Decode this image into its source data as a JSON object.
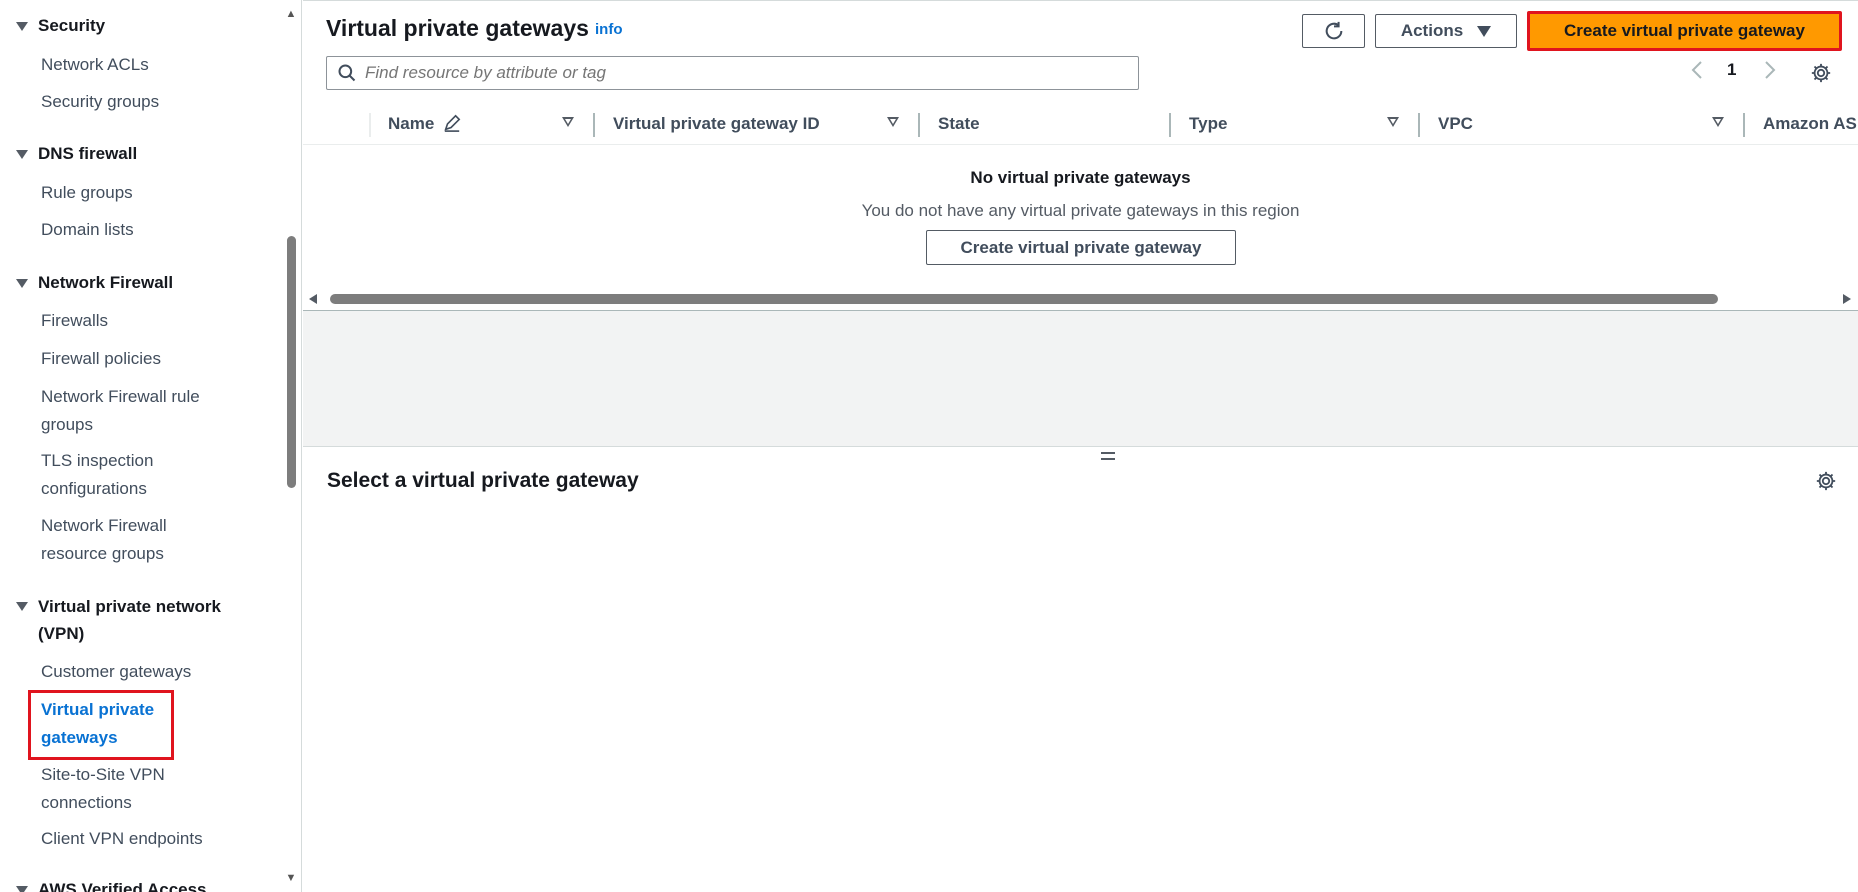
{
  "sidebar": {
    "sections": [
      {
        "label": "Security",
        "items": [
          "Network ACLs",
          "Security groups"
        ]
      },
      {
        "label": "DNS firewall",
        "items": [
          "Rule groups",
          "Domain lists"
        ]
      },
      {
        "label": "Network Firewall",
        "items": [
          "Firewalls",
          "Firewall policies",
          "Network Firewall rule groups",
          "TLS inspection configurations",
          "Network Firewall resource groups"
        ]
      },
      {
        "label": "Virtual private network (VPN)",
        "items": [
          "Customer gateways",
          "Virtual private gateways",
          "Site-to-Site VPN connections",
          "Client VPN endpoints"
        ]
      },
      {
        "label": "AWS Verified Access"
      }
    ],
    "active_item": "Virtual private gateways"
  },
  "header": {
    "title": "Virtual private gateways",
    "info_link": "info",
    "actions_label": "Actions",
    "create_label": "Create virtual private gateway"
  },
  "search": {
    "placeholder": "Find resource by attribute or tag"
  },
  "pagination": {
    "current_page": "1"
  },
  "table": {
    "columns": [
      "Name",
      "Virtual private gateway ID",
      "State",
      "Type",
      "VPC",
      "Amazon AS"
    ],
    "empty_title": "No virtual private gateways",
    "empty_description": "You do not have any virtual private gateways in this region",
    "empty_button": "Create virtual private gateway"
  },
  "detail_panel": {
    "title": "Select a virtual private gateway"
  },
  "colors": {
    "accent": "#0972d3",
    "primary_button": "#ff9900",
    "highlight": "#e0141e"
  }
}
